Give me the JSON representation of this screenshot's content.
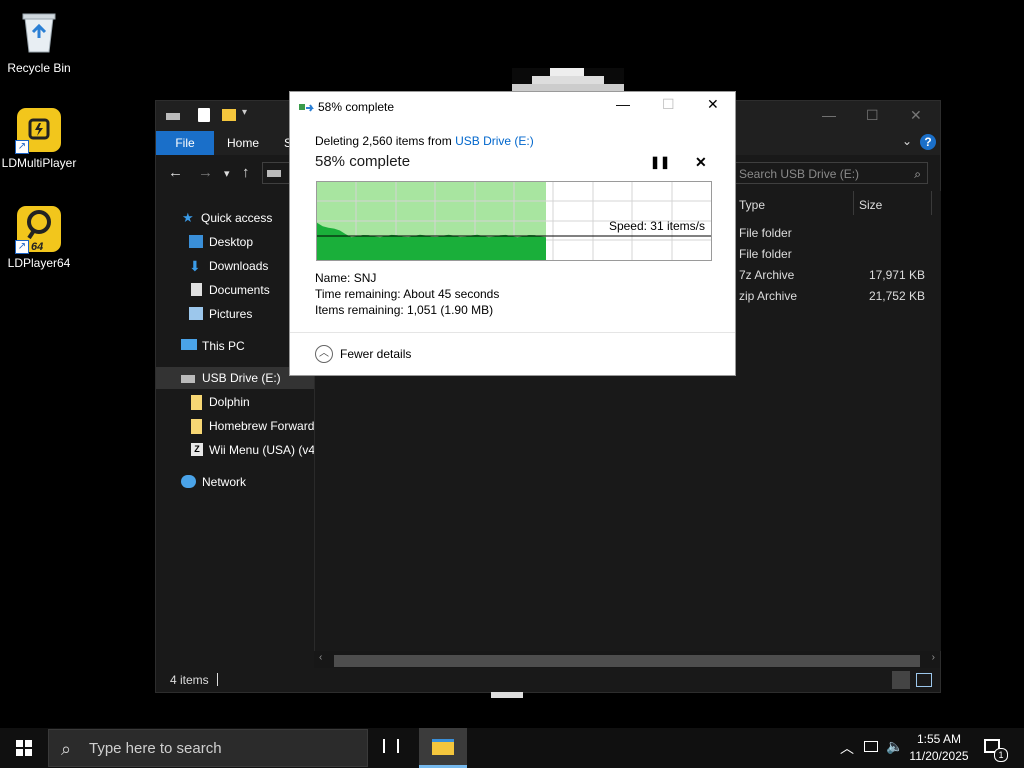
{
  "desktop": {
    "icons": [
      {
        "label": "Recycle Bin"
      },
      {
        "label": "LDMultiPlayer"
      },
      {
        "label": "LDPlayer64",
        "badge": "64"
      }
    ]
  },
  "explorer": {
    "ribbon": {
      "file": "File",
      "home": "Home",
      "share_partial": "S"
    },
    "search_placeholder": "Search USB Drive (E:)",
    "nav": {
      "quick_access": "Quick access",
      "desktop": "Desktop",
      "downloads": "Downloads",
      "documents": "Documents",
      "pictures": "Pictures",
      "this_pc": "This PC",
      "usb_drive": "USB Drive (E:)",
      "dolphin": "Dolphin",
      "homebrew": "Homebrew Forwarder",
      "wii_menu": "Wii Menu (USA) (v4",
      "network": "Network"
    },
    "columns": {
      "type": "Type",
      "size": "Size"
    },
    "rows": [
      {
        "type": "File folder",
        "size": ""
      },
      {
        "type": "File folder",
        "size": ""
      },
      {
        "type": "7z Archive",
        "size": "17,971 KB"
      },
      {
        "type": "zip Archive",
        "size": "21,752 KB"
      }
    ],
    "status": {
      "items": "4 items"
    }
  },
  "dialog": {
    "title": "58% complete",
    "deleting_prefix": "Deleting 2,560 items from ",
    "source_link": "USB Drive (E:)",
    "heading": "58% complete",
    "speed": "Speed: 31 items/s",
    "progress": 0.58,
    "name_label": "Name:",
    "name_value": "SNJ",
    "time_label": "Time remaining:",
    "time_value": "About 45 seconds",
    "items_label": "Items remaining:",
    "items_value": "1,051 (1.90 MB)",
    "fewer_details": "Fewer details"
  },
  "taskbar": {
    "search_placeholder": "Type here to search",
    "time": "1:55 AM",
    "date": "11/20/2025",
    "notification_count": "1"
  },
  "colors": {
    "accent": "#1a6fc9",
    "graph_fill": "#1aaf3a",
    "graph_bg": "#a8e5a0",
    "link": "#0066cc"
  }
}
